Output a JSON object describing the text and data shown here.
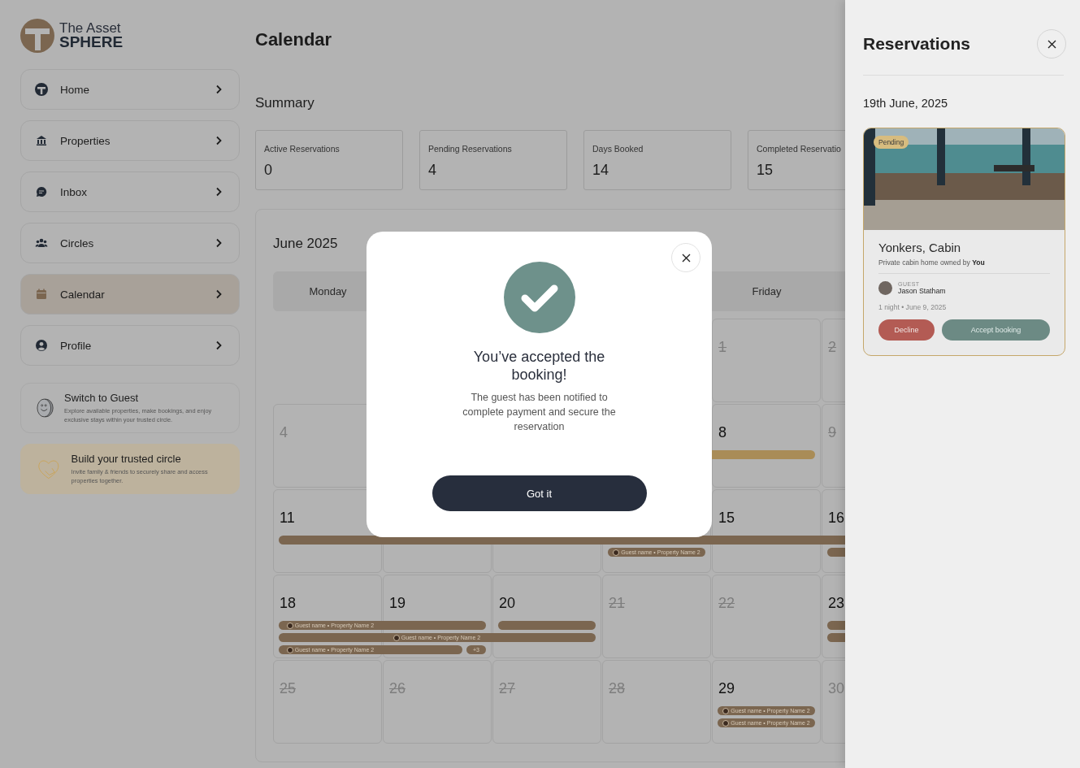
{
  "brand": {
    "line1": "The Asset",
    "line2": "SPHERE"
  },
  "nav": [
    {
      "label": "Home",
      "selected": false
    },
    {
      "label": "Properties",
      "selected": false
    },
    {
      "label": "Inbox",
      "selected": false
    },
    {
      "label": "Circles",
      "selected": false
    },
    {
      "label": "Calendar",
      "selected": true
    },
    {
      "label": "Profile",
      "selected": false
    }
  ],
  "promos": [
    {
      "kind": "guest",
      "title": "Switch to Guest",
      "text": "Explore available properties, make bookings, and enjoy exclusive stays within your trusted circle."
    },
    {
      "kind": "circle",
      "title": "Build your trusted circle",
      "text": "Invite family & friends to securely share and access properties together."
    }
  ],
  "page_title": "Calendar",
  "summary": {
    "title": "Summary",
    "cards": [
      {
        "label": "Active Reservations",
        "value": "0"
      },
      {
        "label": "Pending Reservations",
        "value": "4"
      },
      {
        "label": "Days Booked",
        "value": "14"
      },
      {
        "label": "Completed Reservatio",
        "value": "15"
      }
    ]
  },
  "calendar": {
    "title": "June 2025",
    "weekdays": {
      "mon": "Monday",
      "fri": "Friday"
    },
    "weeks": [
      {
        "days": [
          {
            "kind": "none"
          },
          {
            "kind": "none"
          },
          {
            "kind": "none"
          },
          {
            "kind": "none"
          },
          {
            "day": "1",
            "kind": "past"
          },
          {
            "day": "2",
            "kind": "past"
          }
        ]
      },
      {
        "days": [
          {
            "day": "4",
            "kind": "muted"
          },
          {
            "kind": "hidden"
          },
          {
            "kind": "hidden"
          },
          {
            "kind": "hidden"
          },
          {
            "day": "8",
            "kind": "normal",
            "bars": [
              {
                "color": "#a98c57",
                "continued": true,
                "continues": false
              }
            ]
          },
          {
            "day": "9",
            "kind": "past"
          }
        ]
      },
      {
        "days": [
          {
            "day": "11",
            "kind": "normal",
            "bars": [
              {
                "color": "#7b6650",
                "continues": true
              }
            ]
          },
          {
            "kind": "hidden",
            "bars": [
              {
                "color": "#7b6650",
                "continues": true
              }
            ]
          },
          {
            "kind": "hidden",
            "bars": [
              {
                "color": "#7b6650",
                "continues": true
              }
            ]
          },
          {
            "kind": "hidden",
            "bars": [
              {
                "color": "#7b6650",
                "continues": true
              },
              {
                "color": "#7b6650",
                "continues": false,
                "label": "Guest name • Property Name 2"
              }
            ]
          },
          {
            "day": "15",
            "kind": "normal",
            "bars": [
              {
                "color": "#7b6650",
                "continues": true
              }
            ]
          },
          {
            "day": "16",
            "kind": "normal",
            "bars": [
              {
                "color": "#7b6650",
                "continues": true
              },
              {
                "color": "#7b6650",
                "continues": true
              }
            ]
          }
        ]
      },
      {
        "days": [
          {
            "day": "18",
            "kind": "normal",
            "bars": [
              {
                "color": "#7b6650",
                "continues": true,
                "label": "Guest name • Property Name 2"
              },
              {
                "color": "#7b6650",
                "continues": true
              },
              {
                "color": "#7b6650",
                "continues": true,
                "label": "Guest name • Property Name 2"
              }
            ]
          },
          {
            "day": "19",
            "kind": "normal",
            "bars": [
              {
                "color": "#7b6650",
                "continues": false
              },
              {
                "color": "#7b6650",
                "continues": true,
                "label": "Guest name • Property Name 2"
              },
              {
                "color": "#7b6650",
                "continues": false,
                "more": "+3"
              }
            ]
          },
          {
            "day": "20",
            "kind": "normal",
            "bars": [
              {
                "color": "#7b6650",
                "continues": false
              },
              {
                "color": "#7b6650",
                "continues": false
              }
            ]
          },
          {
            "day": "21",
            "kind": "past"
          },
          {
            "day": "22",
            "kind": "past"
          },
          {
            "day": "23",
            "kind": "normal",
            "bars": [
              {
                "color": "#7b6650",
                "continues": true
              },
              {
                "color": "#7b6650",
                "continues": true
              }
            ]
          }
        ]
      },
      {
        "days": [
          {
            "day": "25",
            "kind": "past"
          },
          {
            "day": "26",
            "kind": "past"
          },
          {
            "day": "27",
            "kind": "past"
          },
          {
            "day": "28",
            "kind": "past"
          },
          {
            "day": "29",
            "kind": "normal",
            "bars": [
              {
                "color": "#7b6650",
                "continues": false,
                "label": "Guest name • Property Name 2"
              },
              {
                "color": "#7b6650",
                "continues": false,
                "label": "Guest name • Property Name 2"
              }
            ]
          },
          {
            "day": "30",
            "kind": "muted"
          }
        ]
      }
    ]
  },
  "reservations": {
    "title": "Reservations",
    "date": "19th June, 2025",
    "card": {
      "status": "Pending",
      "name": "Yonkers, Cabin",
      "description": "Private cabin home owned by **You**",
      "guest_label": "GUEST",
      "guest": "Jason Statham",
      "meta": "1 night • June 9, 2025",
      "decline": "Decline",
      "accept": "Accept booking"
    }
  },
  "dialog": {
    "title": "You’ve accepted the booking!",
    "message": "The guest has been notified to complete payment and secure the reservation",
    "button": "Got it"
  }
}
